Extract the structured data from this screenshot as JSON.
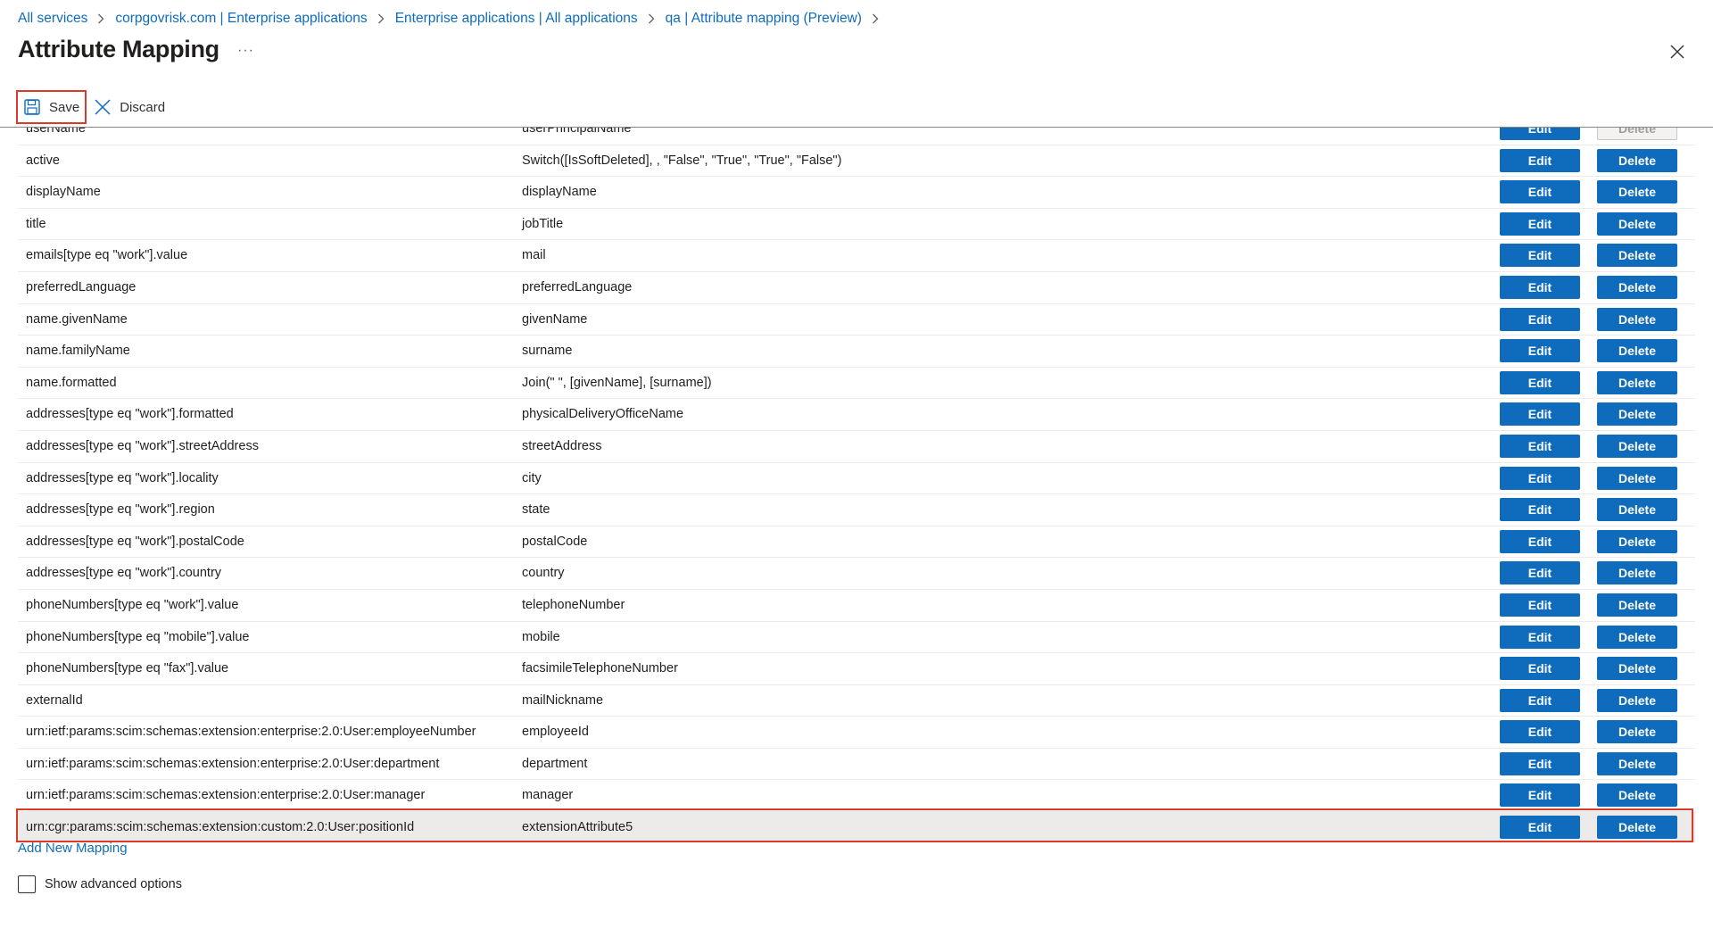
{
  "breadcrumb": [
    {
      "label": "All services"
    },
    {
      "label": "corpgovrisk.com | Enterprise applications"
    },
    {
      "label": "Enterprise applications | All applications"
    },
    {
      "label": "qa | Attribute mapping (Preview)"
    }
  ],
  "title": "Attribute Mapping",
  "more_label": "···",
  "toolbar": {
    "save_label": "Save",
    "discard_label": "Discard"
  },
  "mappings": [
    {
      "target": "userName",
      "source": "userPrincipalName"
    },
    {
      "target": "active",
      "source": "Switch([IsSoftDeleted], , \"False\", \"True\", \"True\", \"False\")"
    },
    {
      "target": "displayName",
      "source": "displayName"
    },
    {
      "target": "title",
      "source": "jobTitle"
    },
    {
      "target": "emails[type eq \"work\"].value",
      "source": "mail"
    },
    {
      "target": "preferredLanguage",
      "source": "preferredLanguage"
    },
    {
      "target": "name.givenName",
      "source": "givenName"
    },
    {
      "target": "name.familyName",
      "source": "surname"
    },
    {
      "target": "name.formatted",
      "source": "Join(\" \", [givenName], [surname])"
    },
    {
      "target": "addresses[type eq \"work\"].formatted",
      "source": "physicalDeliveryOfficeName"
    },
    {
      "target": "addresses[type eq \"work\"].streetAddress",
      "source": "streetAddress"
    },
    {
      "target": "addresses[type eq \"work\"].locality",
      "source": "city"
    },
    {
      "target": "addresses[type eq \"work\"].region",
      "source": "state"
    },
    {
      "target": "addresses[type eq \"work\"].postalCode",
      "source": "postalCode"
    },
    {
      "target": "addresses[type eq \"work\"].country",
      "source": "country"
    },
    {
      "target": "phoneNumbers[type eq \"work\"].value",
      "source": "telephoneNumber"
    },
    {
      "target": "phoneNumbers[type eq \"mobile\"].value",
      "source": "mobile"
    },
    {
      "target": "phoneNumbers[type eq \"fax\"].value",
      "source": "facsimileTelephoneNumber"
    },
    {
      "target": "externalId",
      "source": "mailNickname"
    },
    {
      "target": "urn:ietf:params:scim:schemas:extension:enterprise:2.0:User:employeeNumber",
      "source": "employeeId"
    },
    {
      "target": "urn:ietf:params:scim:schemas:extension:enterprise:2.0:User:department",
      "source": "department"
    },
    {
      "target": "urn:ietf:params:scim:schemas:extension:enterprise:2.0:User:manager",
      "source": "manager"
    },
    {
      "target": "urn:cgr:params:scim:schemas:extension:custom:2.0:User:positionId",
      "source": "extensionAttribute5",
      "highlighted": true
    }
  ],
  "buttons": {
    "edit_label": "Edit",
    "delete_label": "Delete"
  },
  "add_new_mapping_label": "Add New Mapping",
  "show_advanced_label": "Show advanced options",
  "show_advanced_checked": false,
  "colors": {
    "accent": "#0f6cbd",
    "highlight_border": "#d93b2b"
  }
}
